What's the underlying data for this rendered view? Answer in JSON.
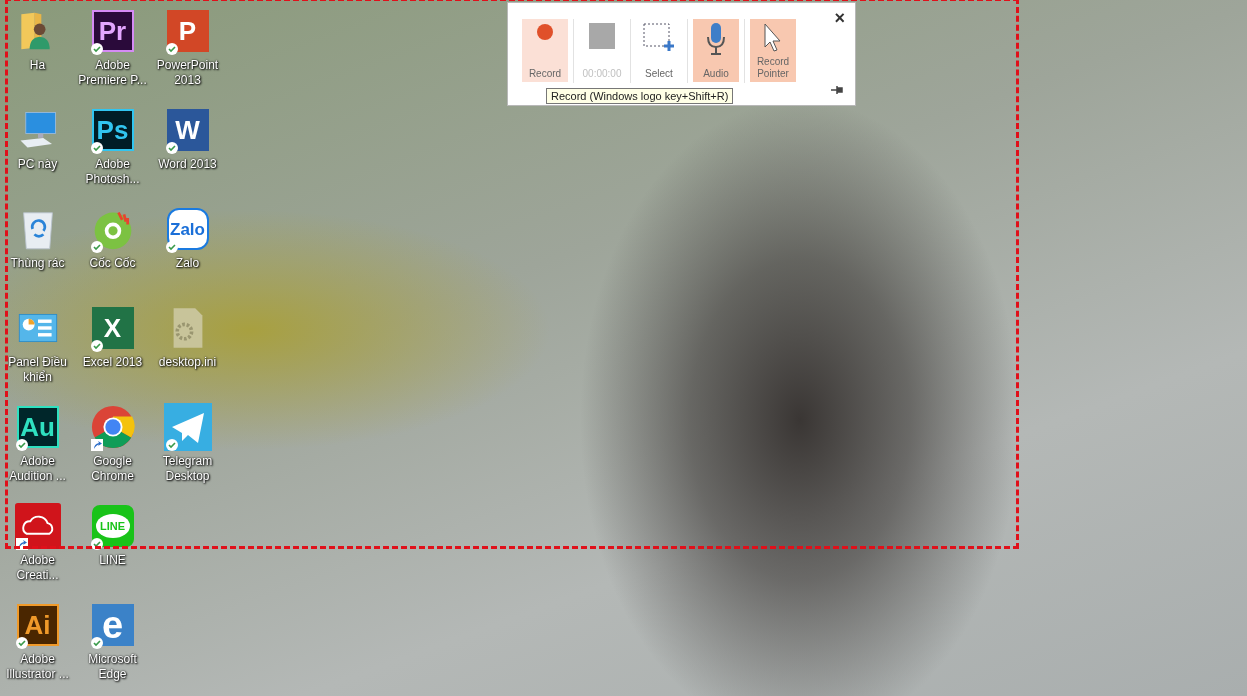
{
  "desktop_icons": [
    {
      "label": "Ha",
      "kind": "user-folder",
      "synced": false,
      "shortcut": false
    },
    {
      "label": "PC này",
      "kind": "computer",
      "synced": false,
      "shortcut": false
    },
    {
      "label": "Thùng rác",
      "kind": "recycle-bin",
      "synced": false,
      "shortcut": false
    },
    {
      "label": "Panel Điều khiển",
      "kind": "control-panel",
      "synced": false,
      "shortcut": false
    },
    {
      "label": "Adobe Audition ...",
      "kind": "audition",
      "glyph": "Au",
      "synced": true,
      "shortcut": false
    },
    {
      "label": "Adobe Creati...",
      "kind": "creative-cloud",
      "synced": false,
      "shortcut": true
    },
    {
      "label": "Adobe Illustrator ...",
      "kind": "illustrator",
      "glyph": "Ai",
      "synced": true,
      "shortcut": false
    },
    {
      "label": "Adobe Premiere P...",
      "kind": "premiere",
      "glyph": "Pr",
      "synced": true,
      "shortcut": false
    },
    {
      "label": "Adobe Photosh...",
      "kind": "photoshop",
      "glyph": "Ps",
      "synced": true,
      "shortcut": false
    },
    {
      "label": "Cốc Cốc",
      "kind": "coccoc",
      "synced": true,
      "shortcut": false
    },
    {
      "label": "Excel 2013",
      "kind": "excel",
      "glyph": "X",
      "synced": true,
      "shortcut": false
    },
    {
      "label": "Google Chrome",
      "kind": "chrome",
      "synced": false,
      "shortcut": true
    },
    {
      "label": "LINE",
      "kind": "line",
      "glyph": "LINE",
      "synced": true,
      "shortcut": false
    },
    {
      "label": "Microsoft Edge",
      "kind": "edge",
      "glyph": "e",
      "synced": true,
      "shortcut": false
    },
    {
      "label": "PowerPoint 2013",
      "kind": "powerpoint",
      "glyph": "P",
      "synced": true,
      "shortcut": false
    },
    {
      "label": "Word 2013",
      "kind": "word",
      "glyph": "W",
      "synced": true,
      "shortcut": false
    },
    {
      "label": "Zalo",
      "kind": "zalo",
      "glyph": "Zalo",
      "synced": true,
      "shortcut": false
    },
    {
      "label": "desktop.ini",
      "kind": "settings-file",
      "synced": false,
      "shortcut": false
    },
    {
      "label": "Telegram Desktop",
      "kind": "telegram",
      "synced": true,
      "shortcut": false
    }
  ],
  "recording_toolbar": {
    "buttons": [
      {
        "kind": "record",
        "label": "Record",
        "selected": false,
        "hovered": true,
        "disabled": false
      },
      {
        "kind": "stop",
        "label": "00:00:00",
        "selected": false,
        "hovered": false,
        "disabled": true
      },
      {
        "kind": "select-area",
        "label": "Select",
        "selected": false,
        "hovered": false,
        "disabled": false
      },
      {
        "kind": "audio",
        "label": "Audio",
        "selected": true,
        "hovered": false,
        "disabled": false
      },
      {
        "kind": "pointer",
        "label": "Record Pointer",
        "selected": true,
        "hovered": false,
        "disabled": false
      }
    ],
    "close": "×",
    "tooltip": "Record (Windows logo key+Shift+R)"
  }
}
